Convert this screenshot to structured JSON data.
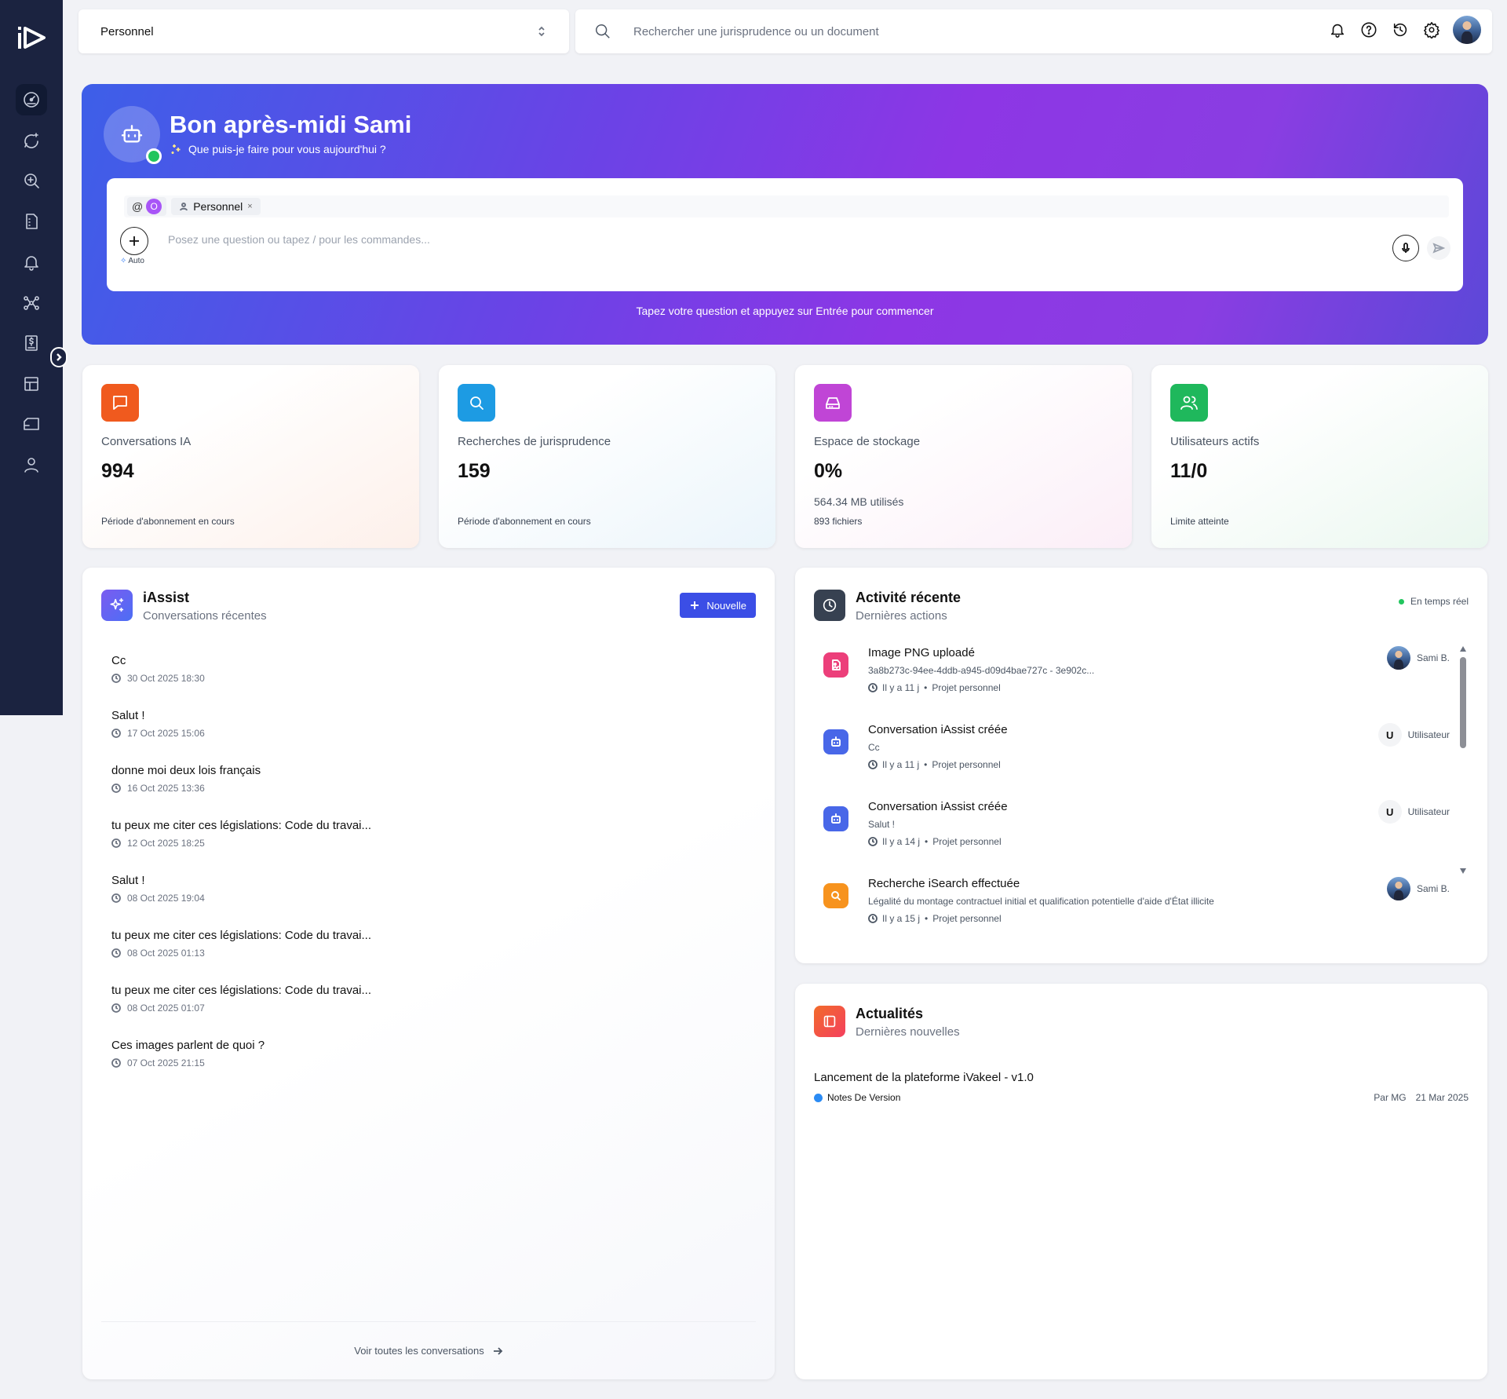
{
  "colors": {
    "sidebar": "#1b2340",
    "accent": "#3b4ee6",
    "online": "#22c55e"
  },
  "sidebar": {
    "items": [
      {
        "icon": "dashboard-icon"
      },
      {
        "icon": "sparkle-chat-icon"
      },
      {
        "icon": "search-law-icon"
      },
      {
        "icon": "document-icon"
      },
      {
        "icon": "bell-icon"
      },
      {
        "icon": "workflow-icon"
      },
      {
        "icon": "legal-book-icon"
      },
      {
        "icon": "template-icon"
      },
      {
        "icon": "folder-icon"
      },
      {
        "icon": "user-icon"
      }
    ]
  },
  "topbar": {
    "workspace": "Personnel",
    "search_placeholder": "Rechercher une jurisprudence ou un document"
  },
  "hero": {
    "title": "Bon après-midi Sami",
    "subtitle": "Que puis-je faire pour vous aujourd'hui ?",
    "chip_at": "@",
    "chip_o": "O",
    "chip_workspace": "Personnel",
    "chip_close": "×",
    "auto_label": "Auto",
    "prompt_placeholder": "Posez une question ou tapez / pour les commandes...",
    "hint": "Tapez votre question et appuyez sur Entrée pour commencer"
  },
  "stats": [
    {
      "label": "Conversations IA",
      "value": "994",
      "sub1": "",
      "sub2": "Période d'abonnement en cours",
      "color": "#f05a1e"
    },
    {
      "label": "Recherches de jurisprudence",
      "value": "159",
      "sub1": "",
      "sub2": "Période d'abonnement en cours",
      "color": "#1d9be3"
    },
    {
      "label": "Espace de stockage",
      "value": "0%",
      "sub1": "564.34 MB utilisés",
      "sub2": "893 fichiers",
      "color": "#c045d6"
    },
    {
      "label": "Utilisateurs actifs",
      "value": "11/0",
      "sub1": "",
      "sub2": "Limite atteinte",
      "color": "#1fb85c"
    }
  ],
  "iassist": {
    "title": "iAssist",
    "subtitle": "Conversations récentes",
    "new_label": "Nouvelle",
    "conversations": [
      {
        "title": "Cc",
        "date": "30 Oct 2025 18:30"
      },
      {
        "title": "Salut !",
        "date": "17 Oct 2025 15:06"
      },
      {
        "title": "donne moi deux lois français",
        "date": "16 Oct 2025 13:36"
      },
      {
        "title": "tu peux me citer ces législations: Code du travai...",
        "date": "12 Oct 2025 18:25"
      },
      {
        "title": "Salut !",
        "date": "08 Oct 2025 19:04"
      },
      {
        "title": "tu peux me citer ces législations: Code du travai...",
        "date": "08 Oct 2025 01:13"
      },
      {
        "title": "tu peux me citer ces législations: Code du travai...",
        "date": "08 Oct 2025 01:07"
      },
      {
        "title": "Ces images parlent de quoi ?",
        "date": "07 Oct 2025 21:15"
      }
    ],
    "footer": "Voir toutes les conversations"
  },
  "activity": {
    "title": "Activité récente",
    "subtitle": "Dernières actions",
    "realtime": "En temps réel",
    "items": [
      {
        "title": "Image PNG uploadé",
        "detail": "3a8b273c-94ee-4ddb-a945-d09d4bae727c - 3e902c...",
        "time": "Il y a 11 j",
        "sep": "•",
        "project": "Projet personnel",
        "user": "Sami B.",
        "user_type": "avatar",
        "icon": "image-file-icon",
        "color": "#ec3f7a"
      },
      {
        "title": "Conversation iAssist créée",
        "detail": "Cc",
        "time": "Il y a 11 j",
        "sep": "•",
        "project": "Projet personnel",
        "user": "Utilisateur",
        "badge": "U",
        "user_type": "badge",
        "icon": "bot-icon",
        "color": "#4867e8"
      },
      {
        "title": "Conversation iAssist créée",
        "detail": "Salut !",
        "time": "Il y a 14 j",
        "sep": "•",
        "project": "Projet personnel",
        "user": "Utilisateur",
        "badge": "U",
        "user_type": "badge",
        "icon": "bot-icon",
        "color": "#4867e8"
      },
      {
        "title": "Recherche iSearch effectuée",
        "detail": "Légalité du montage contractuel initial et qualification potentielle d'aide d'État illicite",
        "time": "Il y a 15 j",
        "sep": "•",
        "project": "Projet personnel",
        "user": "Sami B.",
        "user_type": "avatar",
        "icon": "search-icon",
        "color": "#f7931e"
      }
    ]
  },
  "news": {
    "title": "Actualités",
    "subtitle": "Dernières nouvelles",
    "items": [
      {
        "title": "Lancement de la plateforme iVakeel - v1.0",
        "tag": "Notes De Version",
        "author": "Par MG",
        "date": "21 Mar 2025"
      }
    ]
  }
}
